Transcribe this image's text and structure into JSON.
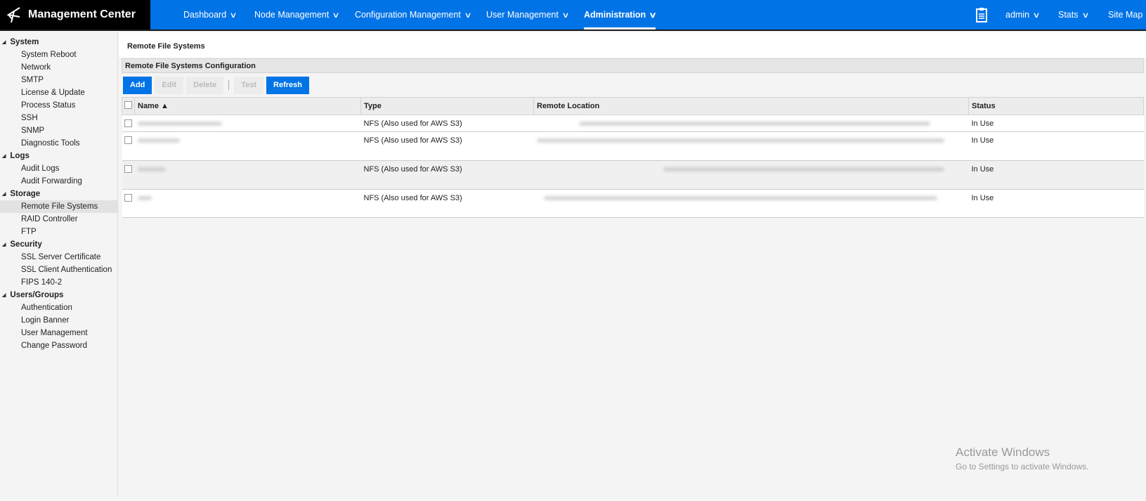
{
  "header": {
    "brand": "Management Center",
    "nav": [
      {
        "label": "Dashboard"
      },
      {
        "label": "Node Management"
      },
      {
        "label": "Configuration Management"
      },
      {
        "label": "User Management"
      },
      {
        "label": "Administration"
      }
    ],
    "user": "admin",
    "stats": "Stats",
    "sitemap": "Site Map"
  },
  "sidebar": {
    "groups": [
      {
        "label": "System",
        "items": [
          "System Reboot",
          "Network",
          "SMTP",
          "License & Update",
          "Process Status",
          "SSH",
          "SNMP",
          "Diagnostic Tools"
        ]
      },
      {
        "label": "Logs",
        "items": [
          "Audit Logs",
          "Audit Forwarding"
        ]
      },
      {
        "label": "Storage",
        "items": [
          "Remote File Systems",
          "RAID Controller",
          "FTP"
        ]
      },
      {
        "label": "Security",
        "items": [
          "SSL Server Certificate",
          "SSL Client Authentication",
          "FIPS 140-2"
        ]
      },
      {
        "label": "Users/Groups",
        "items": [
          "Authentication",
          "Login Banner",
          "User Management",
          "Change Password"
        ]
      }
    ],
    "selected": "Remote File Systems"
  },
  "page": {
    "title": "Remote File Systems",
    "panel_title": "Remote File Systems Configuration",
    "toolbar": {
      "add": "Add",
      "edit": "Edit",
      "delete": "Delete",
      "test": "Test",
      "refresh": "Refresh"
    },
    "columns": {
      "name": "Name ▲",
      "type": "Type",
      "location": "Remote Location",
      "status": "Status"
    },
    "rows": [
      {
        "type": "NFS (Also used for AWS S3)",
        "status": "In Use"
      },
      {
        "type": "NFS (Also used for AWS S3)",
        "status": "In Use"
      },
      {
        "type": "NFS (Also used for AWS S3)",
        "status": "In Use"
      },
      {
        "type": "NFS (Also used for AWS S3)",
        "status": "In Use"
      }
    ]
  },
  "watermark": {
    "title": "Activate Windows",
    "sub": "Go to Settings to activate Windows."
  }
}
